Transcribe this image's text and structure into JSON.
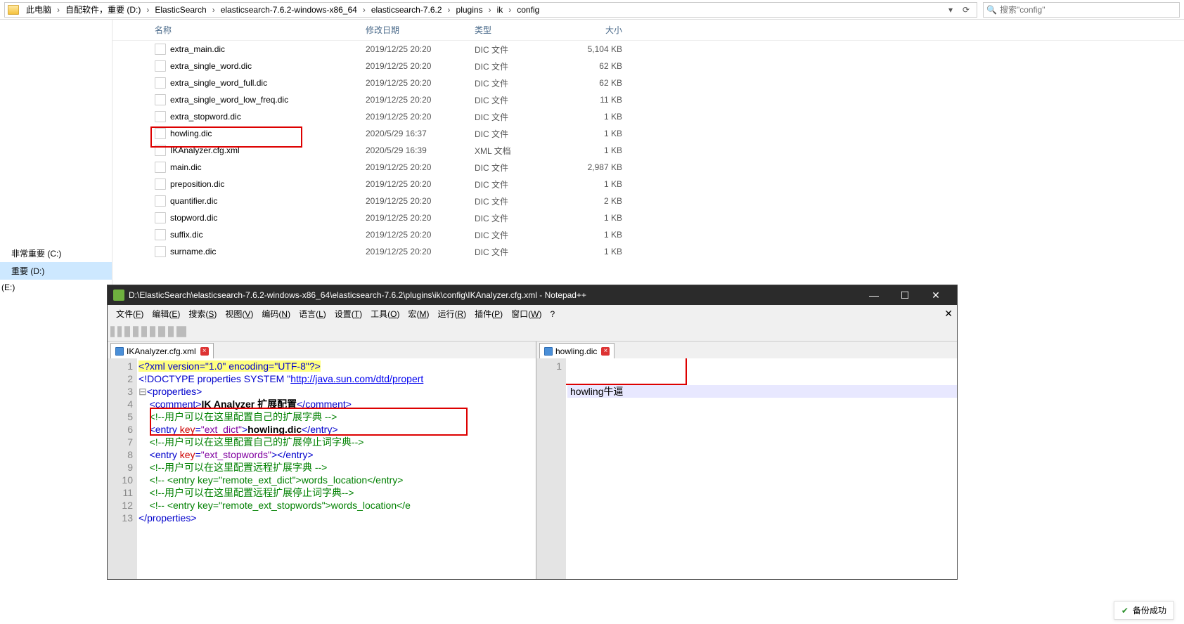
{
  "breadcrumb": [
    "此电脑",
    "自配软件，重要 (D:)",
    "ElasticSearch",
    "elasticsearch-7.6.2-windows-x86_64",
    "elasticsearch-7.6.2",
    "plugins",
    "ik",
    "config"
  ],
  "search_placeholder": "搜索\"config\"",
  "columns": {
    "name": "名称",
    "date": "修改日期",
    "type": "类型",
    "size": "大小"
  },
  "files": [
    {
      "name": "extra_main.dic",
      "date": "2019/12/25 20:20",
      "type": "DIC 文件",
      "size": "5,104 KB"
    },
    {
      "name": "extra_single_word.dic",
      "date": "2019/12/25 20:20",
      "type": "DIC 文件",
      "size": "62 KB"
    },
    {
      "name": "extra_single_word_full.dic",
      "date": "2019/12/25 20:20",
      "type": "DIC 文件",
      "size": "62 KB"
    },
    {
      "name": "extra_single_word_low_freq.dic",
      "date": "2019/12/25 20:20",
      "type": "DIC 文件",
      "size": "11 KB"
    },
    {
      "name": "extra_stopword.dic",
      "date": "2019/12/25 20:20",
      "type": "DIC 文件",
      "size": "1 KB"
    },
    {
      "name": "howling.dic",
      "date": "2020/5/29 16:37",
      "type": "DIC 文件",
      "size": "1 KB"
    },
    {
      "name": "IKAnalyzer.cfg.xml",
      "date": "2020/5/29 16:39",
      "type": "XML 文档",
      "size": "1 KB"
    },
    {
      "name": "main.dic",
      "date": "2019/12/25 20:20",
      "type": "DIC 文件",
      "size": "2,987 KB"
    },
    {
      "name": "preposition.dic",
      "date": "2019/12/25 20:20",
      "type": "DIC 文件",
      "size": "1 KB"
    },
    {
      "name": "quantifier.dic",
      "date": "2019/12/25 20:20",
      "type": "DIC 文件",
      "size": "2 KB"
    },
    {
      "name": "stopword.dic",
      "date": "2019/12/25 20:20",
      "type": "DIC 文件",
      "size": "1 KB"
    },
    {
      "name": "suffix.dic",
      "date": "2019/12/25 20:20",
      "type": "DIC 文件",
      "size": "1 KB"
    },
    {
      "name": "surname.dic",
      "date": "2019/12/25 20:20",
      "type": "DIC 文件",
      "size": "1 KB"
    }
  ],
  "sidebar": {
    "drive_c": "非常重要 (C:)",
    "drive_d": "重要 (D:)",
    "drive_e": "(E:)"
  },
  "npp": {
    "title": "D:\\ElasticSearch\\elasticsearch-7.6.2-windows-x86_64\\elasticsearch-7.6.2\\plugins\\ik\\config\\IKAnalyzer.cfg.xml - Notepad++",
    "menu": [
      "文件(F)",
      "编辑(E)",
      "搜索(S)",
      "视图(V)",
      "编码(N)",
      "语言(L)",
      "设置(T)",
      "工具(O)",
      "宏(M)",
      "运行(R)",
      "插件(P)",
      "窗口(W)",
      "?"
    ],
    "tab_left": "IKAnalyzer.cfg.xml",
    "tab_right": "howling.dic",
    "right_content": "howling牛逼",
    "left_lines": {
      "l1_pi": "<?xml version=\"1.0\" encoding=\"UTF-8\"?>",
      "l2_a": "<!DOCTYPE properties SYSTEM \"",
      "l2_link": "http://java.sun.com/dtd/propert",
      "l3": "<properties>",
      "l4_open": "<comment>",
      "l4_text": "IK Analyzer 扩展配置",
      "l4_close": "</comment>",
      "l5": "<!--用户可以在这里配置自己的扩展字典 -->",
      "l6_a": "<entry ",
      "l6_key": "key",
      "l6_eq": "=",
      "l6_val": "\"ext_dict\"",
      "l6_b": ">",
      "l6_text": "howling.dic",
      "l6_close": "</entry>",
      "l7": "<!--用户可以在这里配置自己的扩展停止词字典-->",
      "l8_a": "<entry ",
      "l8_key": "key",
      "l8_eq": "=",
      "l8_val": "\"ext_stopwords\"",
      "l8_b": ">",
      "l8_close": "</entry>",
      "l9": "<!--用户可以在这里配置远程扩展字典 -->",
      "l10": "<!-- <entry key=\"remote_ext_dict\">words_location</entry>",
      "l11": "<!--用户可以在这里配置远程扩展停止词字典-->",
      "l12": "<!-- <entry key=\"remote_ext_stopwords\">words_location</e",
      "l13": "</properties>"
    }
  },
  "status_text": "备份成功"
}
